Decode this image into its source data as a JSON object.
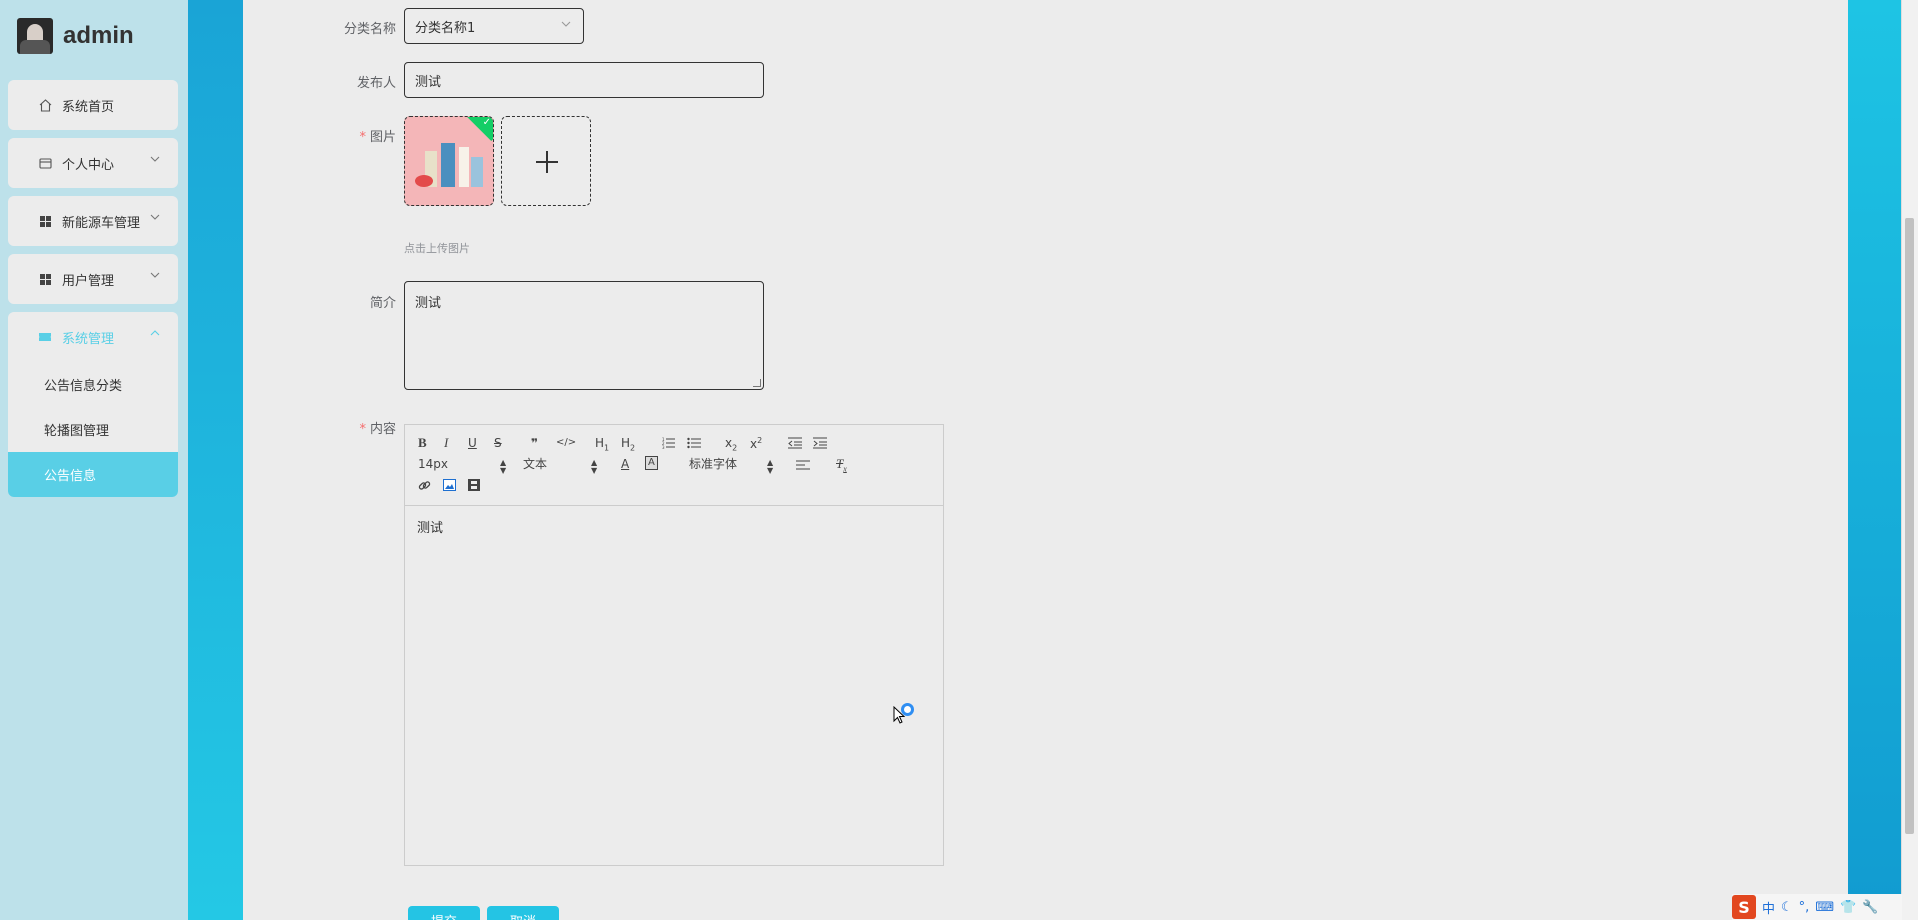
{
  "brand": {
    "name": "admin"
  },
  "sidebar": {
    "items": [
      {
        "label": "系统首页",
        "icon": "home-icon"
      },
      {
        "label": "个人中心",
        "icon": "wallet-icon"
      },
      {
        "label": "新能源车管理",
        "icon": "grid-icon"
      },
      {
        "label": "用户管理",
        "icon": "grid-icon"
      },
      {
        "label": "系统管理",
        "icon": "ticket-icon"
      }
    ],
    "sub_items": [
      {
        "label": "公告信息分类"
      },
      {
        "label": "轮播图管理"
      },
      {
        "label": "公告信息"
      }
    ]
  },
  "form": {
    "category_label": "分类名称",
    "category_value": "分类名称1",
    "publisher_label": "发布人",
    "publisher_value": "测试",
    "image_label": "图片",
    "upload_tip": "点击上传图片",
    "intro_label": "简介",
    "intro_value": "测试",
    "content_label": "内容",
    "content_value": "测试",
    "required_mark": "*"
  },
  "editor": {
    "font_size": "14px",
    "paragraph": "文本",
    "font_family": "标准字体"
  },
  "buttons": {
    "submit": "提交",
    "cancel": "取消"
  },
  "tray": {
    "ime": "中",
    "logo": "S"
  },
  "colors": {
    "accent": "#59cfe6",
    "band": "#1aa4d6",
    "button": "#24c4e4"
  }
}
